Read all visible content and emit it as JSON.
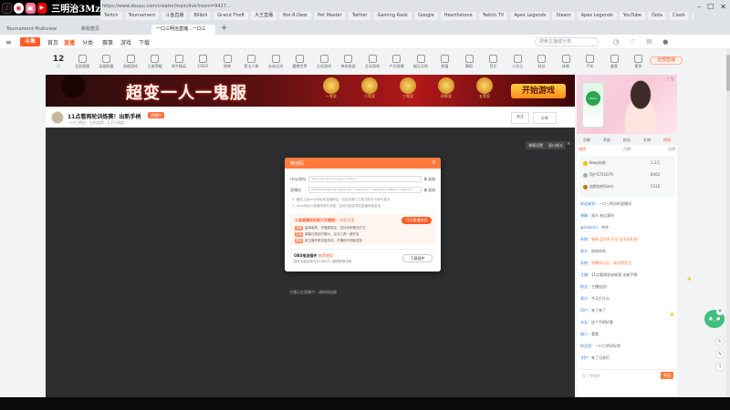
{
  "corner": {
    "overlay_text": "三明治3Mz",
    "icons": [
      "tiktok-icon",
      "weibo-icon",
      "bilibili-icon",
      "youtube-icon"
    ]
  },
  "browser": {
    "bookmarks": [
      "Twitch",
      "Tournament",
      "斗鱼直播",
      "Bilibili",
      "Grand Theft",
      "大王直播",
      "Bot.R.Dear",
      "Pet Master",
      "Twitter",
      "Gaming Rank",
      "Google",
      "Hearthstone",
      "Twitch TV",
      "Apex Legends",
      "Steam",
      "Apex Legends",
      "YouTube",
      "Dota",
      "Clash",
      "Twitch"
    ],
    "tabs": [
      {
        "label": "Tournament Multiview"
      },
      {
        "label": "新标签页"
      }
    ],
    "active_tab": "一口三明治直播...一口三",
    "new_tab": "+"
  },
  "site": {
    "logo": "斗鱼",
    "nav": [
      "首页",
      "直播",
      "分类",
      "赛事",
      "游戏",
      "下载"
    ],
    "search_placeholder": "搜索主播或分类"
  },
  "date": {
    "day": "12",
    "month": "月"
  },
  "categories": [
    "全部直播",
    "英雄联盟",
    "网络游戏",
    "王者荣耀",
    "和平精英",
    "CSGO",
    "原神",
    "第五人格",
    "永劫无间",
    "魔兽世界",
    "主机游戏",
    "单机热游",
    "互动游戏",
    "户外直播",
    "娱乐天地",
    "颜值",
    "舞蹈",
    "音乐",
    "二次元",
    "科技",
    "体育",
    "汽车",
    "美食",
    "更多"
  ],
  "category_more": "全部直播",
  "banner": {
    "title": "超变一人一鬼服",
    "prizes": [
      "一等奖",
      "二等奖",
      "三等奖",
      "四等奖",
      "五等奖"
    ],
    "cta": "开始游戏",
    "ad_tag": "广告"
  },
  "stream": {
    "title": "11点看两轮训练赛！出新手柄",
    "badge": "直播中",
    "meta": "一口三明治 · 主机游戏 · 1.2万热度",
    "follow": "关注",
    "share": "分享"
  },
  "player": {
    "btn_a": "弹幕设置",
    "btn_b": "窗口模式",
    "close": "×",
    "hint": "主播正在直播中，请稍候加载"
  },
  "modal": {
    "title": "推流码",
    "close": "×",
    "rows": [
      {
        "label": "rtmp地址",
        "value": "rtmp://sendtc3a.douyu.com/live",
        "copy": "复制"
      },
      {
        "label": "直播码",
        "value": "2487923rh6gb3zJr?wsSecret=...&wsTime=...&wsSeek=off&wm=0&tw=0",
        "copy": "复制"
      }
    ],
    "notes": [
      "1. 播放上述rtmp地址和直播码后，粘贴到第三方推流软件中即可推流",
      "2. rtmp地址与直播码请勿泄露，否则可能会导致直播间被盗用"
    ],
    "promo": {
      "title": "斗鱼直播伴侣助力开播啦！",
      "promo_sub": "领取优惠",
      "button": "打开直播伴侣",
      "lines": [
        {
          "tag": "功能",
          "text": "高清画质，开播更稳定，支持多种推流方式"
        },
        {
          "tag": "互动",
          "text": "弹幕礼物实时展示，互动工具一键开启"
        },
        {
          "tag": "福利",
          "text": "新主播专属流量扶持，开播即可领取奖励"
        }
      ]
    },
    "assist": {
      "title": "OBS推流插件",
      "title_sub": "推荐使用",
      "desc": "插件安装后即可在OBS中一键获取推流码",
      "button": "下载插件"
    }
  },
  "sidebar": {
    "ad_brand": "Dettol",
    "tabs": [
      "贡献",
      "贵族",
      "粉丝",
      "礼物",
      "榜单"
    ],
    "active_tab": 4,
    "subtabs": [
      "周榜",
      "月榜",
      "总榜"
    ],
    "rank": [
      {
        "name": "Keep向前",
        "value": "1.2万"
      },
      {
        "name": "用户5721079",
        "value": "8462"
      },
      {
        "name": "加斯加的Sami",
        "value": "5310"
      }
    ],
    "chat": [
      {
        "user": "欢迎来到",
        "text": "一口三明治的直播间"
      },
      {
        "user": "弹幕",
        "text": "观众 有比赛吗"
      },
      {
        "user": "@mikomi",
        "text": "冲冲"
      },
      {
        "user": "系统",
        "text": "感谢 蓝色的天空 送出的礼物"
      },
      {
        "user": "观众",
        "text": "哈哈哈哈"
      },
      {
        "user": "系统",
        "text": "直播间公告：请文明发言"
      },
      {
        "user": "主播",
        "text": "11点看两轮训练赛 出新手柄"
      },
      {
        "user": "粉丝",
        "text": "主播加油！"
      },
      {
        "user": "观众",
        "text": "今天打什么"
      },
      {
        "user": "用户",
        "text": "来了来了"
      },
      {
        "user": "水友",
        "text": "这个手柄好看"
      },
      {
        "user": "路人",
        "text": "看看"
      },
      {
        "user": "粉丝团",
        "text": "一口三明治好帅"
      },
      {
        "user": "守护",
        "text": "来了兄弟们"
      }
    ],
    "chat_placeholder": "发个弹幕吧",
    "send": "发送"
  }
}
